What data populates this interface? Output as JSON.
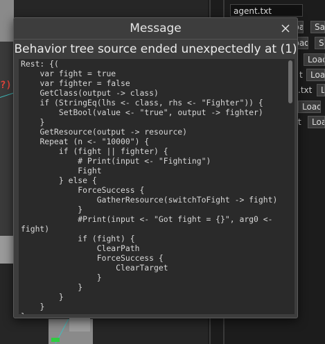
{
  "dialog": {
    "title": "Message",
    "heading": "Behavior tree source ended unexpectedly at (1)",
    "close_icon": "close-icon",
    "code": "Rest: {(\n    var fight = true\n    var fighter = false\n    GetClass(output -> class)\n    if (StringEq(lhs <- class, rhs <- \"Fighter\")) {\n        SetBool(value <- \"true\", output -> fighter)\n    }\n    GetResource(output -> resource)\n    Repeat (n <- \"10000\") {\n        if (fight || fighter) {\n            # Print(input <- \"Fighting\")\n            Fight\n        } else {\n            ForceSuccess {\n                GatherResource(switchToFight -> fight)\n            }\n            #Print(input <- \"Got fight = {}\", arg0 <- fight)\n            if (fight) {\n                ClearPath\n                ForceSuccess {\n                    ClearTarget\n                }\n            }\n        }\n    }\n}"
  },
  "background": {
    "filename": "agent.txt",
    "buttons": [
      {
        "label": "Load"
      },
      {
        "label": "Sav"
      },
      {
        "label": "Load"
      },
      {
        "label": "Sa"
      },
      {
        "label": "Load"
      },
      {
        "label": "Load"
      },
      {
        "label": "Lo"
      },
      {
        "label": "Load"
      },
      {
        "label": "Load"
      }
    ],
    "labels": [
      {
        "text": "t"
      },
      {
        "text": ".txt"
      },
      {
        "text": "t"
      }
    ],
    "marker_text": "?)",
    "colors": {
      "accent_line": "#3fbfbf",
      "marker": "#e0443a",
      "unit": "#2ecc40"
    }
  }
}
